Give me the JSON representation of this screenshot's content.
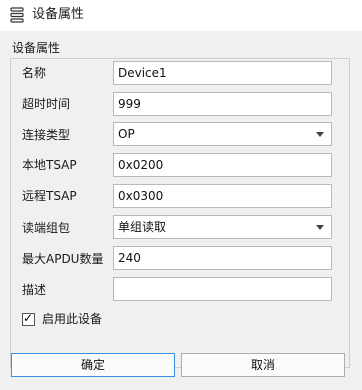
{
  "window": {
    "title": "设备属性",
    "icon": "list-icon"
  },
  "group": {
    "label": "设备属性"
  },
  "fields": {
    "name": {
      "label": "名称",
      "value": "Device1"
    },
    "timeout": {
      "label": "超时时间",
      "value": "999"
    },
    "connection_type": {
      "label": "连接类型",
      "value": "OP"
    },
    "local_tsap": {
      "label": "本地TSAP",
      "value": "0x0200"
    },
    "remote_tsap": {
      "label": "远程TSAP",
      "value": "0x0300"
    },
    "read_write_group": {
      "label": "读端组包",
      "value": "单组读取"
    },
    "max_apdu": {
      "label": "最大APDU数量",
      "value": "240"
    },
    "description": {
      "label": "描述",
      "value": ""
    }
  },
  "enable": {
    "label": "启用此设备",
    "checked": true,
    "mark": "✓"
  },
  "buttons": {
    "ok": "确定",
    "cancel": "取消"
  },
  "colors": {
    "accent": "#3c8fe0",
    "panel": "#f0f0f0"
  }
}
